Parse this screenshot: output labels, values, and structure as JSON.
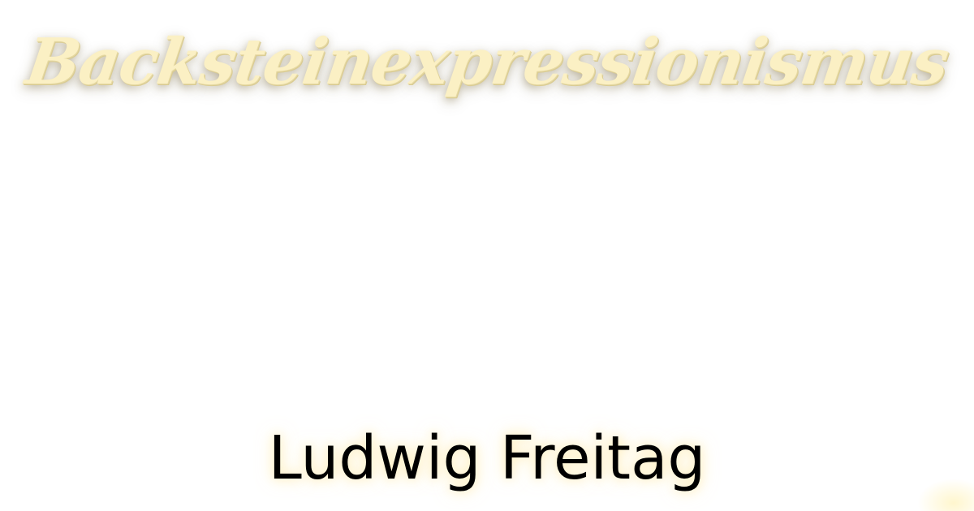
{
  "title": "Backsteinexpressionismus",
  "author": "Ludwig Freitag",
  "colors": {
    "background": "#ffffff",
    "title_fill": "#fbf0c4",
    "author_text": "#000000"
  }
}
